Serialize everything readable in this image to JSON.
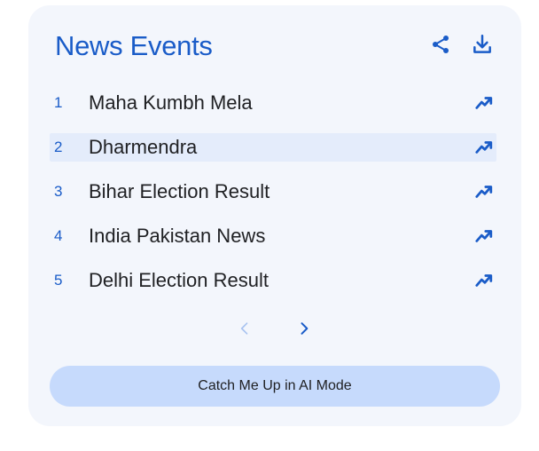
{
  "panel": {
    "title": "News Events",
    "share_icon": "share-icon",
    "download_icon": "download-icon"
  },
  "events": [
    {
      "rank": "1",
      "label": "Maha Kumbh Mela",
      "icon": "trending-up-icon",
      "highlighted": false
    },
    {
      "rank": "2",
      "label": "Dharmendra",
      "icon": "trending-up-icon",
      "highlighted": true
    },
    {
      "rank": "3",
      "label": "Bihar Election Result",
      "icon": "trending-up-icon",
      "highlighted": false
    },
    {
      "rank": "4",
      "label": "India Pakistan News",
      "icon": "trending-up-icon",
      "highlighted": false
    },
    {
      "rank": "5",
      "label": "Delhi Election Result",
      "icon": "trending-up-icon",
      "highlighted": false
    }
  ],
  "pagination": {
    "prev_icon": "chevron-left-icon",
    "next_icon": "chevron-right-icon",
    "prev_enabled": false,
    "next_enabled": true
  },
  "cta": {
    "label": "Catch Me Up in AI Mode"
  },
  "colors": {
    "accent": "#1a5cc8",
    "card_bg": "#f3f6fc",
    "highlight_bg": "#e4ecfb",
    "cta_bg": "#c6dafc",
    "disabled": "#a8c3f0"
  }
}
